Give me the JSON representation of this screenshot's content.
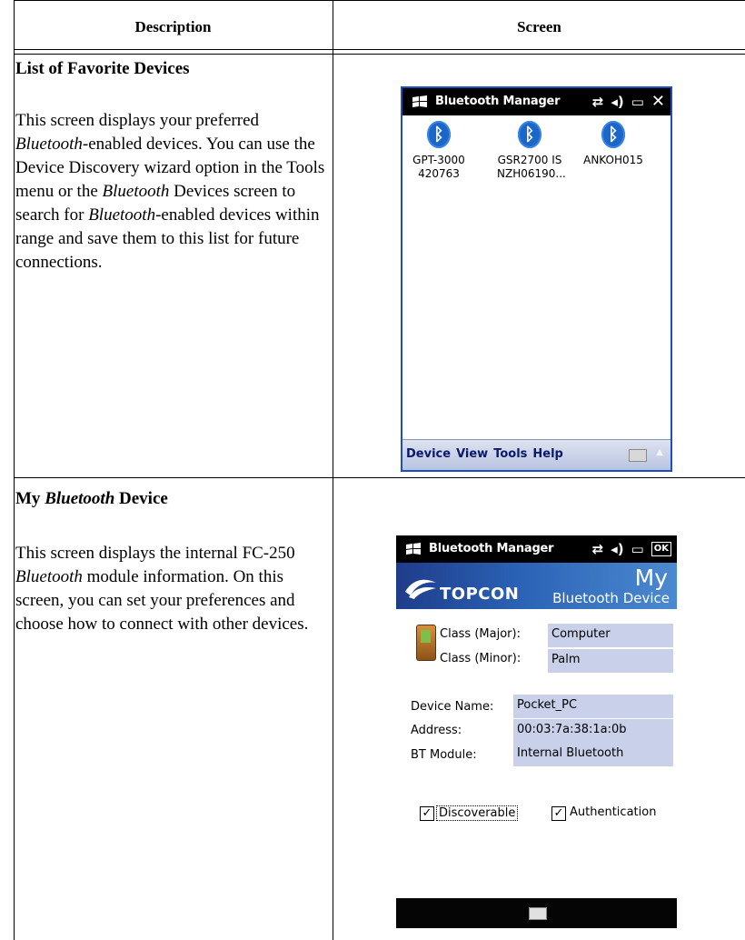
{
  "table": {
    "col_description": "Description",
    "col_screen": "Screen"
  },
  "row1": {
    "title": "List of Favorite Devices",
    "body_html_parts": [
      "This screen displays your preferred ",
      "Bluetooth",
      "-enabled devices. You can use the Device Discovery wizard option in the Tools menu or the ",
      "Bluetooth",
      " Devices screen to search for ",
      "Bluetooth",
      "-enabled devices within range and save them to this list for future connections."
    ],
    "screen": {
      "title": "Bluetooth Manager",
      "devices": [
        {
          "line1": "GPT-3000",
          "line2": "420763"
        },
        {
          "line1": "GSR2700 IS",
          "line2": "NZH06190..."
        },
        {
          "line1": "ANKOH015",
          "line2": ""
        }
      ],
      "menu": [
        "Device",
        "View",
        "Tools",
        "Help"
      ],
      "accent_color": "#1a67c9"
    }
  },
  "row2": {
    "title_a": "My ",
    "title_b": "Bluetooth",
    "title_c": " Device",
    "body_parts": [
      "This screen displays the internal FC-250 ",
      "Bluetooth",
      " module information. On this screen, you can set your preferences and choose how to connect with other devices."
    ],
    "screen": {
      "title": "Bluetooth Manager",
      "brand": "TOPCON",
      "heading_big": "My",
      "heading_small": "Bluetooth Device",
      "fields": [
        {
          "label": "Class (Major):",
          "value": "Computer"
        },
        {
          "label": "Class (Minor):",
          "value": "Palm"
        },
        {
          "label": "Device Name:",
          "value": "Pocket_PC"
        },
        {
          "label": "Address:",
          "value": "00:03:7a:38:1a:0b"
        },
        {
          "label": "BT Module:",
          "value": "Internal Bluetooth"
        }
      ],
      "checkboxes": [
        {
          "label": "Discoverable",
          "checked": true
        },
        {
          "label": "Authentication",
          "checked": true
        }
      ],
      "ok_label": "OK"
    }
  }
}
